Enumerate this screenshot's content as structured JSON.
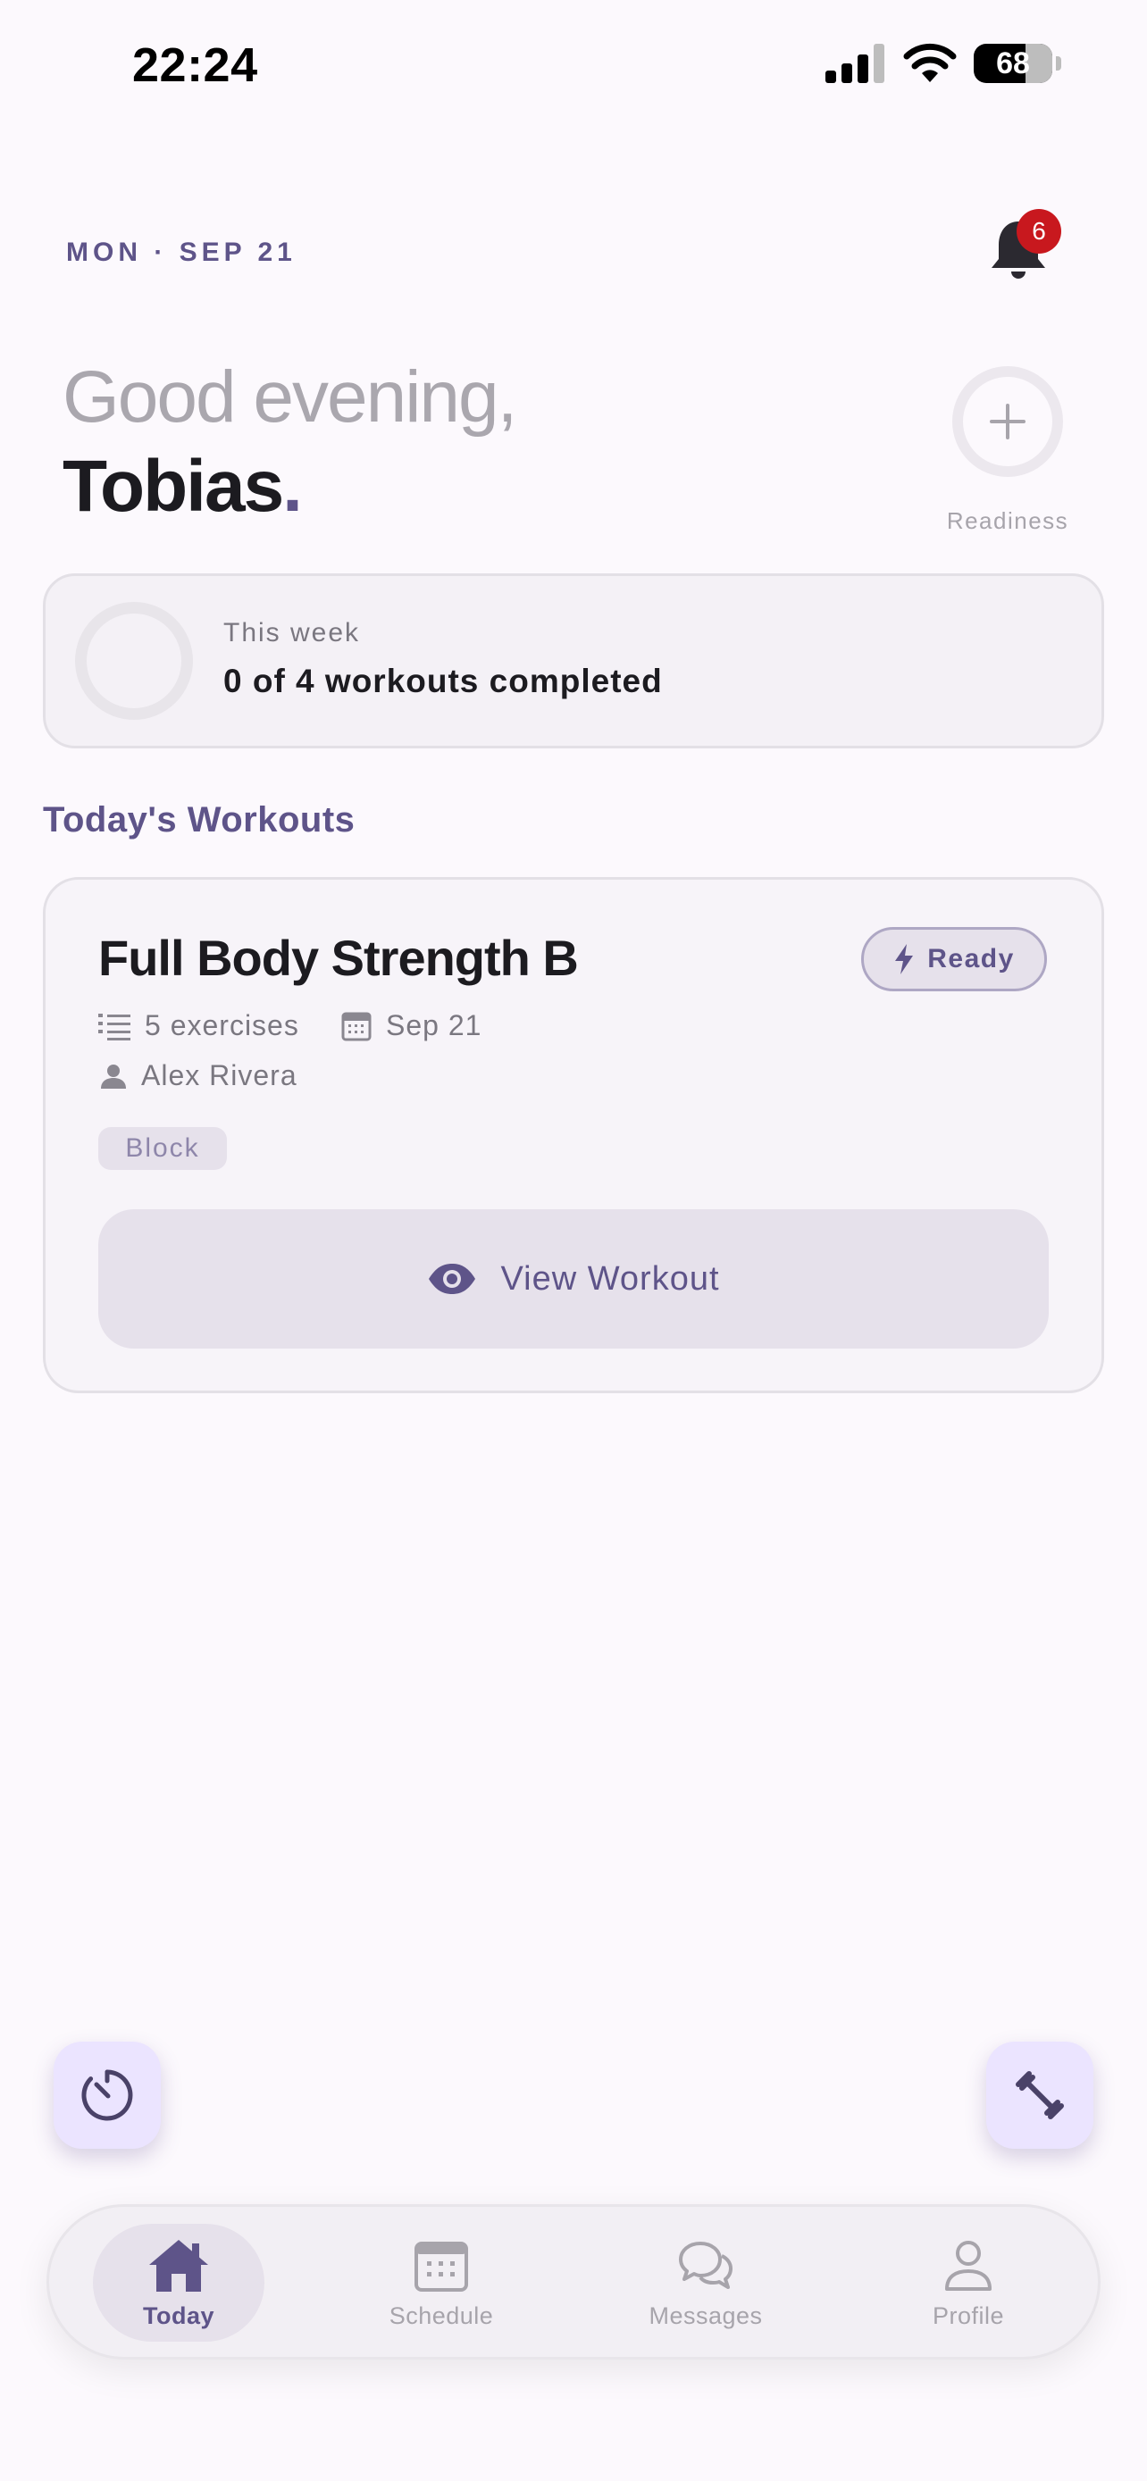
{
  "status_bar": {
    "time": "22:24",
    "battery": "68"
  },
  "header": {
    "date": "MON · SEP 21",
    "notifications_count": "6",
    "greeting": "Good evening,",
    "user_name": "Tobias",
    "name_suffix": ".",
    "readiness_label": "Readiness"
  },
  "week_summary": {
    "label": "This week",
    "value": "0 of 4 workouts completed",
    "progress": 0
  },
  "section_title": "Today's Workouts",
  "workout": {
    "title": "Full Body Strength B",
    "status": "Ready",
    "exercises": "5 exercises",
    "date": "Sep 21",
    "coach": "Alex Rivera",
    "tag": "Block",
    "action_label": "View Workout"
  },
  "nav": {
    "items": [
      {
        "label": "Today",
        "icon": "home-icon",
        "active": true
      },
      {
        "label": "Schedule",
        "icon": "calendar-icon",
        "active": false
      },
      {
        "label": "Messages",
        "icon": "chat-icon",
        "active": false
      },
      {
        "label": "Profile",
        "icon": "person-icon",
        "active": false
      }
    ]
  },
  "colors": {
    "accent": "#5e5489",
    "background": "#fcf9fd",
    "badge": "#c8181e",
    "fab": "#ebe4ff"
  }
}
